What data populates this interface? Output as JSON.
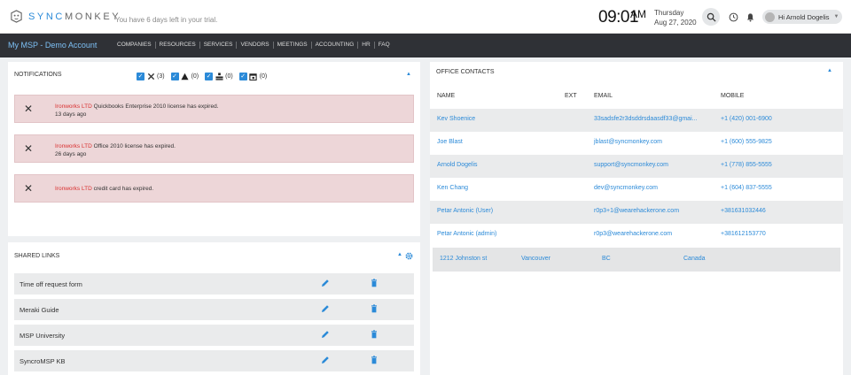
{
  "header": {
    "brand_prefix": "SYNC",
    "brand_suffix": "MONKEY",
    "trial_text": "You have 6 days left in your trial.",
    "time": "09:01",
    "ampm": "AM",
    "weekday": "Thursday",
    "date": "Aug 27, 2020",
    "user_greeting": "Hi Arnold Dogelis"
  },
  "nav": {
    "account": "My MSP - Demo Account",
    "items": [
      "COMPANIES",
      "RESOURCES",
      "SERVICES",
      "VENDORS",
      "MEETINGS",
      "ACCOUNTING",
      "HR",
      "FAQ"
    ]
  },
  "notifications": {
    "title": "NOTIFICATIONS",
    "filters": [
      {
        "icon": "x-icon",
        "count": "(3)"
      },
      {
        "icon": "warning-icon",
        "count": "(0)"
      },
      {
        "icon": "server-icon",
        "count": "(0)"
      },
      {
        "icon": "calendar-icon",
        "count": "(0)"
      }
    ],
    "items": [
      {
        "company": "Ironworks LTD",
        "text": " Quickbooks Enterprise 2010 license has expired.",
        "ago": "13 days ago"
      },
      {
        "company": "Ironworks LTD",
        "text": " Office 2010 license has expired.",
        "ago": "26 days ago"
      },
      {
        "company": "Ironworks LTD",
        "text": " credit card has expired.",
        "ago": ""
      }
    ]
  },
  "shared_links": {
    "title": "SHARED LINKS",
    "items": [
      "Time off request form",
      "Meraki Guide",
      "MSP University",
      "SyncroMSP KB"
    ]
  },
  "office_contacts": {
    "title": "OFFICE CONTACTS",
    "columns": {
      "name": "NAME",
      "ext": "EXT",
      "email": "EMAIL",
      "mobile": "MOBILE"
    },
    "rows": [
      {
        "name": "Kev Shoenice",
        "email": "33sadsfe2r3dsddrsdaasdf33@gmai...",
        "mobile": "+1 (420) 001-6900"
      },
      {
        "name": "Joe Blast",
        "email": "jblast@syncmonkey.com",
        "mobile": "+1 (600) 555-9825"
      },
      {
        "name": "Arnold Dogelis",
        "email": "support@syncmonkey.com",
        "mobile": "+1 (778) 855-5555"
      },
      {
        "name": "Ken Chang",
        "email": "dev@syncmonkey.com",
        "mobile": "+1 (604) 837-5555"
      },
      {
        "name": "Petar Antonic (User)",
        "email": "r0p3+1@wearehackerone.com",
        "mobile": "+381631032446"
      },
      {
        "name": "Petar Antonic (admin)",
        "email": "r0p3@wearehackerone.com",
        "mobile": "+381612153770"
      }
    ],
    "address": {
      "street": "1212 Johnston st",
      "city": "Vancouver",
      "region": "BC",
      "country": "Canada"
    }
  },
  "colors": {
    "accent": "#2b8ad8",
    "nav_bg": "#2f3136",
    "alert_bg": "#edd6d8",
    "company_red": "#d93030"
  }
}
